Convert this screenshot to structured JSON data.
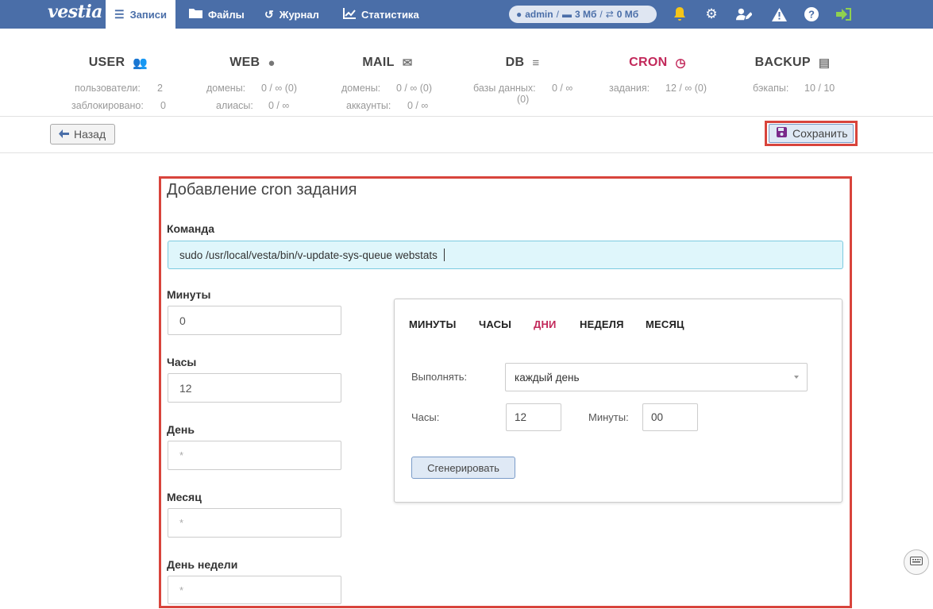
{
  "topbar": {
    "logo": "vestia",
    "nav": [
      {
        "label": "Записи",
        "icon": "list-check-icon",
        "active": true
      },
      {
        "label": "Файлы",
        "icon": "folder-icon",
        "active": false
      },
      {
        "label": "Журнал",
        "icon": "history-icon",
        "active": false
      },
      {
        "label": "Статистика",
        "icon": "chart-line-icon",
        "active": false
      }
    ],
    "user": "admin",
    "disk": "3 Мб",
    "bandwidth": "0 Мб",
    "sep1": "/",
    "sep2": "/",
    "accent": "#4a6ea8"
  },
  "stats": {
    "user": {
      "title": "USER",
      "l1_label": "пользователи:",
      "l1_value": "2",
      "l2_label": "заблокировано:",
      "l2_value": "0"
    },
    "web": {
      "title": "WEB",
      "l1_label": "домены:",
      "l1_value": "0 / ∞ (0)",
      "l2_label": "алиасы:",
      "l2_value": "0 / ∞"
    },
    "mail": {
      "title": "MAIL",
      "l1_label": "домены:",
      "l1_value": "0 / ∞ (0)",
      "l2_label": "аккаунты:",
      "l2_value": "0 / ∞"
    },
    "db": {
      "title": "DB",
      "l1_label": "базы данных:",
      "l1_value": "0 / ∞",
      "l1_extra": "(0)"
    },
    "cron": {
      "title": "CRON",
      "l1_label": "задания:",
      "l1_value": "12 / ∞ (0)",
      "active_color": "#c2285a"
    },
    "backup": {
      "title": "BACKUP",
      "l1_label": "бэкапы:",
      "l1_value": "10 / 10"
    }
  },
  "actions": {
    "back": "Назад",
    "save": "Сохранить"
  },
  "form": {
    "title": "Добавление cron задания",
    "command_label": "Команда",
    "command_value": "sudo /usr/local/vesta/bin/v-update-sys-queue webstats",
    "minutes_label": "Минуты",
    "minutes_value": "0",
    "hours_label": "Часы",
    "hours_value": "12",
    "day_label": "День",
    "day_value": "*",
    "month_label": "Месяц",
    "month_value": "*",
    "weekday_label": "День недели",
    "weekday_value": "*"
  },
  "generator": {
    "tabs": [
      "МИНУТЫ",
      "ЧАСЫ",
      "ДНИ",
      "НЕДЕЛЯ",
      "МЕСЯЦ"
    ],
    "active_tab": "ДНИ",
    "run_label": "Выполнять:",
    "run_value": "каждый день",
    "hours_label": "Часы:",
    "hours_value": "12",
    "minutes_label": "Минуты:",
    "minutes_value": "00",
    "generate": "Сгенерировать"
  }
}
